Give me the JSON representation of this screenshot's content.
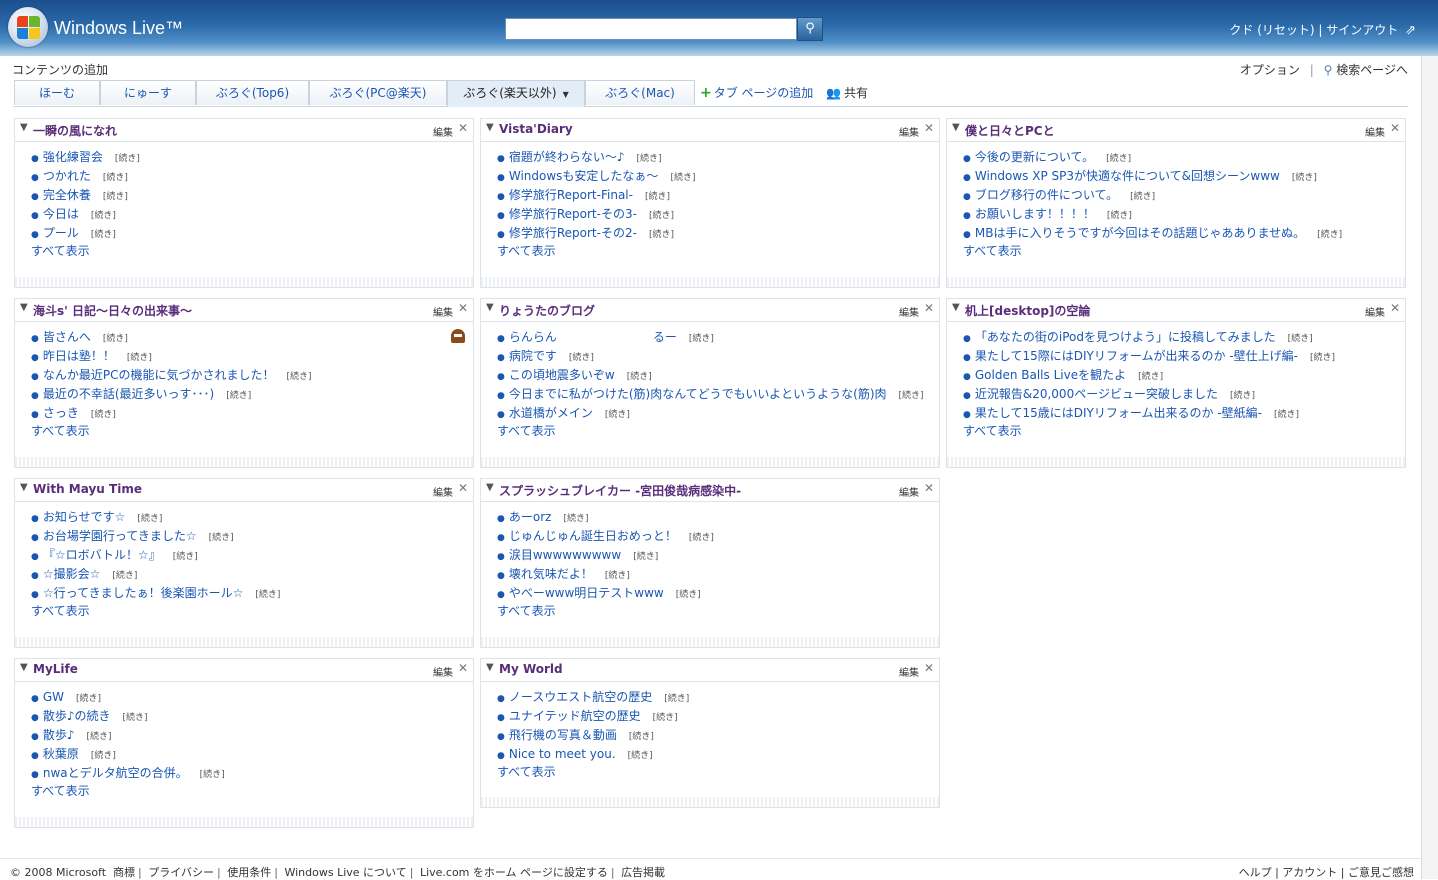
{
  "header": {
    "brand": "Windows Live™",
    "search_placeholder": "",
    "user_links": [
      "クド (リセット)",
      "サインアウト"
    ]
  },
  "subheader": {
    "add_content": "コンテンツの追加",
    "options": "オプション",
    "search_page": "検索ページへ"
  },
  "tabs": [
    {
      "label": "ほーむ",
      "active": false
    },
    {
      "label": "にゅーす",
      "active": false
    },
    {
      "label": "ぶろぐ(Top6)",
      "active": false
    },
    {
      "label": "ぶろぐ(PC@楽天)",
      "active": false
    },
    {
      "label": "ぶろぐ(楽天以外)",
      "active": true
    },
    {
      "label": "ぶろぐ(Mac)",
      "active": false
    }
  ],
  "tab_actions": {
    "add": "タブ ページの追加",
    "share": "共有"
  },
  "gadget_labels": {
    "edit": "編集",
    "close": "✕",
    "more": "[続き]",
    "show_all": "すべて表示"
  },
  "gadgets": [
    {
      "title": "一瞬の風になれ",
      "items": [
        "強化練習会",
        "つかれた",
        "完全休養",
        "今日は",
        "プール"
      ]
    },
    {
      "title": "Vista'Diary",
      "items": [
        "宿題が終わらない～♪",
        "Windowsも安定したなぁ～",
        "修学旅行Report-Final-",
        "修学旅行Report-その3-",
        "修学旅行Report-その2-"
      ]
    },
    {
      "title": "僕と日々とPCと",
      "items": [
        "今後の更新について。",
        "Windows XP SP3が快適な件について&回想シーンwww",
        "ブログ移行の件について。",
        "お願いします！！！！",
        "MBは手に入りそうですが今回はその話題じゃあありませぬ。"
      ]
    },
    {
      "title": "海斗s' 日記～日々の出来事～",
      "items": [
        "皆さんへ",
        "昨日は塾！！",
        "なんか最近PCの機能に気づかされました！",
        "最近の不幸話(最近多いっす･･･)",
        "さっき"
      ]
    },
    {
      "title": "りょうたのブログ",
      "items": [
        "らんらん　　　　　　　　るー",
        "病院です",
        "この頃地震多いぞw",
        "今日までに私がつけた(筋)肉なんてどうでもいいよというような(筋)肉",
        "水道橋がメイン"
      ]
    },
    {
      "title": "机上[desktop]の空論",
      "items": [
        "「あなたの街のiPodを見つけよう」に投稿してみました",
        "果たして15際にはDIYリフォームが出来るのか -壁仕上げ編-",
        "Golden Balls Liveを観たよ",
        "近況報告&20,000ページビュー突破しました",
        "果たして15歳にはDIYリフォーム出来るのか -壁紙編-"
      ]
    },
    {
      "title": "With Mayu Time",
      "items": [
        "お知らせです☆",
        "お台場学園行ってきました☆",
        "『☆ロボバトル！☆』",
        "☆撮影会☆",
        "☆行ってきましたぁ！後楽園ホール☆"
      ]
    },
    {
      "title": "スプラッシュブレイカー -宮田俊哉病感染中-",
      "items": [
        "あーorz",
        "じゅんじゅん誕生日おめっと！",
        "涙目wwwwwwwww",
        "壊れ気味だよ！",
        "やべーwww明日テストwww"
      ]
    },
    {
      "title": "MyLife",
      "items": [
        "GW",
        "散歩♪の続き",
        "散歩♪",
        "秋葉原",
        "nwaとデルタ航空の合併。"
      ]
    },
    {
      "title": "My World",
      "items": [
        "ノースウエスト航空の歴史",
        "ユナイテッド航空の歴史",
        "飛行機の写真＆動画",
        "Nice to meet you."
      ]
    }
  ],
  "footer": {
    "left": [
      "© 2008 Microsoft",
      "商標",
      "プライバシー",
      "使用条件",
      "Windows Live について",
      "Live.com をホーム ページに設定する",
      "広告掲載"
    ],
    "right": [
      "ヘルプ",
      "アカウント",
      "ご意見ご感想"
    ]
  }
}
